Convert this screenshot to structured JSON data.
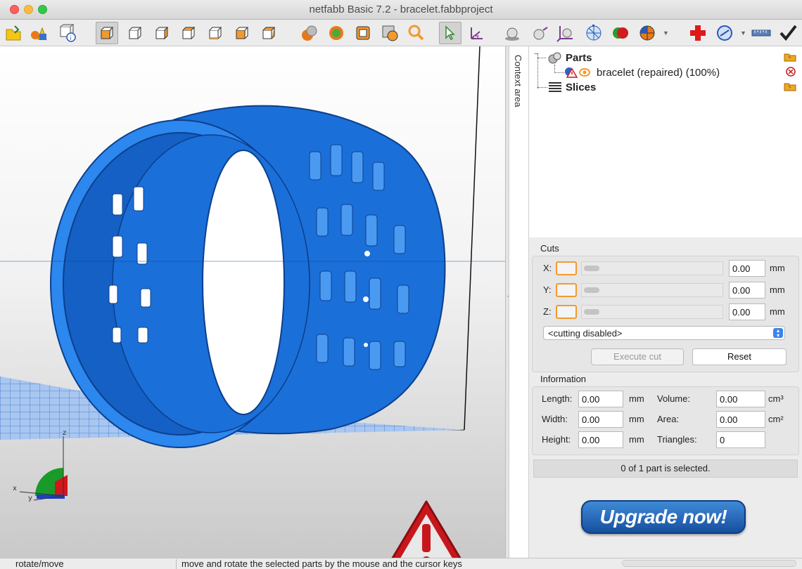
{
  "window": {
    "title": "netfabb Basic 7.2 - bracelet.fabbproject"
  },
  "toolbar": {
    "icons": [
      "open-project-icon",
      "add-part-icon",
      "part-info-icon",
      "view-front-icon",
      "view-back-icon",
      "view-left-icon",
      "view-right-icon",
      "view-top-icon",
      "view-bottom-icon",
      "view-perspective-icon",
      "shading-icon",
      "solid-shading-icon",
      "wireframe-icon",
      "measure-icon",
      "zoom-icon",
      "select-pointer-icon",
      "move-icon",
      "sphere-icon",
      "spheres-icon",
      "axes-icon",
      "mesh-icon",
      "boolean-icon",
      "color-wheel-icon",
      "repair-icon",
      "view-settings-icon",
      "ruler-icon",
      "check-icon"
    ]
  },
  "viewport": {
    "axis_labels": {
      "x": "x",
      "y": "y",
      "z": "z"
    }
  },
  "context_area": {
    "label": "Context area"
  },
  "tree": {
    "parts_label": "Parts",
    "part_name": "bracelet (repaired) (100%)",
    "slices_label": "Slices"
  },
  "cuts": {
    "title": "Cuts",
    "x_label": "X:",
    "x_value": "0.00",
    "y_label": "Y:",
    "y_value": "0.00",
    "z_label": "Z:",
    "z_value": "0.00",
    "unit": "mm",
    "mode": "<cutting disabled>",
    "execute_label": "Execute cut",
    "reset_label": "Reset"
  },
  "information": {
    "title": "Information",
    "length_label": "Length:",
    "length_value": "0.00",
    "width_label": "Width:",
    "width_value": "0.00",
    "height_label": "Height:",
    "height_value": "0.00",
    "unit_mm": "mm",
    "volume_label": "Volume:",
    "volume_value": "0.00",
    "volume_unit": "cm³",
    "area_label": "Area:",
    "area_value": "0.00",
    "area_unit": "cm²",
    "triangles_label": "Triangles:",
    "triangles_value": "0"
  },
  "selection": {
    "status": "0 of 1 part is selected."
  },
  "upgrade": {
    "label": "Upgrade now!"
  },
  "statusbar": {
    "mode": "rotate/move",
    "hint": "move and rotate the selected parts by the mouse and the cursor keys"
  },
  "colors": {
    "model": "#1d78e0",
    "accent_orange": "#f39a2e",
    "warning_red": "#c8171c"
  }
}
